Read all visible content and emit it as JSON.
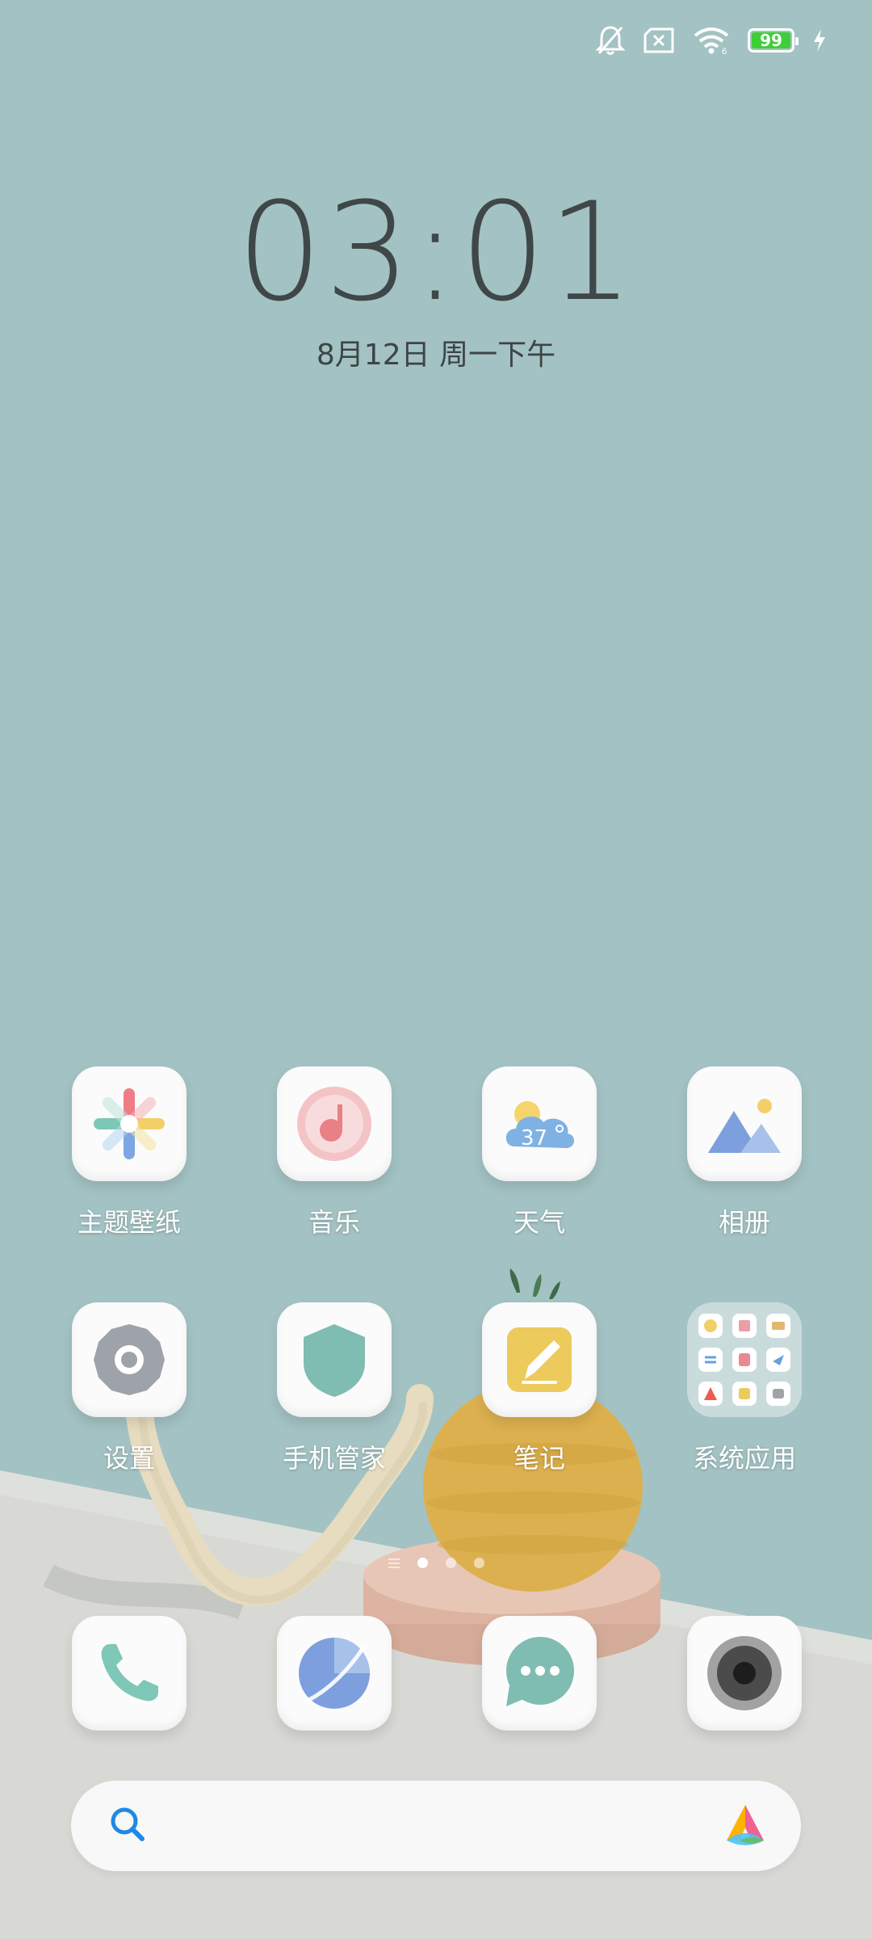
{
  "status_bar": {
    "battery_level": "99",
    "icons": [
      "mute-icon",
      "no-sim-icon",
      "wifi-icon",
      "battery-icon",
      "charging-icon"
    ]
  },
  "lockscreen": {
    "time": "03:01",
    "date": "8月12日 周一下午"
  },
  "apps": [
    {
      "label": "主题壁纸",
      "icon": "themes-icon"
    },
    {
      "label": "音乐",
      "icon": "music-icon"
    },
    {
      "label": "天气",
      "icon": "weather-icon",
      "temp": "37"
    },
    {
      "label": "相册",
      "icon": "gallery-icon"
    },
    {
      "label": "设置",
      "icon": "settings-icon"
    },
    {
      "label": "手机管家",
      "icon": "security-icon"
    },
    {
      "label": "笔记",
      "icon": "notes-icon"
    },
    {
      "label": "系统应用",
      "icon": "system-apps-folder-icon"
    }
  ],
  "dock": [
    {
      "icon": "phone-icon"
    },
    {
      "icon": "browser-icon"
    },
    {
      "icon": "messages-icon"
    },
    {
      "icon": "camera-icon"
    }
  ],
  "page_indicator": {
    "pages": 3,
    "current": 1
  },
  "search": {
    "placeholder": ""
  },
  "colors": {
    "wallpaper": "#a3c2c3",
    "table": "#dcddd9",
    "battery_green": "#3fce3a",
    "search_accent": "#1e88e5"
  }
}
